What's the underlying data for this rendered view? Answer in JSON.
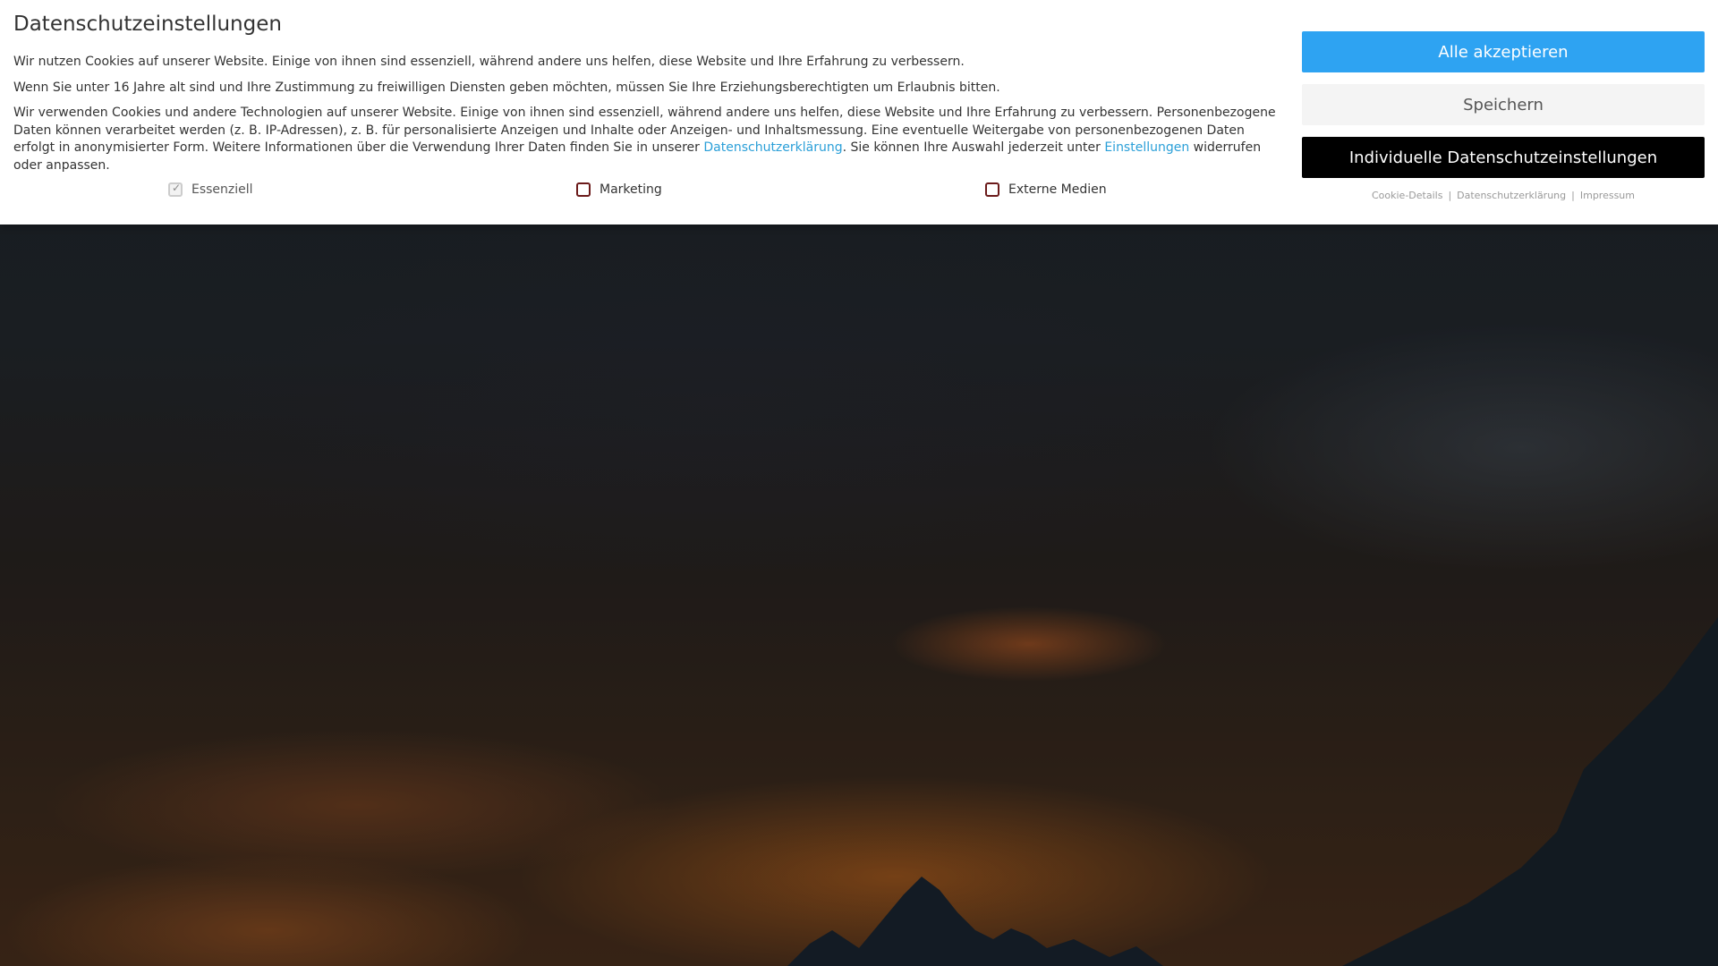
{
  "banner": {
    "title": "Datenschutzeinstellungen",
    "paragraph1": "Wir nutzen Cookies auf unserer Website. Einige von ihnen sind essenziell, während andere uns helfen, diese Website und Ihre Erfahrung zu verbessern.",
    "paragraph2": "Wenn Sie unter 16 Jahre alt sind und Ihre Zustimmung zu freiwilligen Diensten geben möchten, müssen Sie Ihre Erziehungsberechtigten um Erlaubnis bitten.",
    "paragraph3_part1": "Wir verwenden Cookies und andere Technologien auf unserer Website. Einige von ihnen sind essenziell, während andere uns helfen, diese Website und Ihre Erfahrung zu verbessern. Personenbezogene Daten können verarbeitet werden (z. B. IP-Adressen), z. B. für personalisierte Anzeigen und Inhalte oder Anzeigen- und Inhaltsmessung. Eine eventuelle Weitergabe von personenbezogenen Daten erfolgt in anonymisierter Form. Weitere Informationen über die Verwendung Ihrer Daten finden Sie in unserer ",
    "privacy_link": "Datenschutzerklärung",
    "paragraph3_part2": ". Sie können Ihre Auswahl jederzeit unter ",
    "settings_link": "Einstellungen",
    "paragraph3_part3": " widerrufen oder anpassen.",
    "categories": [
      {
        "label": "Essenziell",
        "checked": true,
        "disabled": true
      },
      {
        "label": "Marketing",
        "checked": false,
        "disabled": false
      },
      {
        "label": "Externe Medien",
        "checked": false,
        "disabled": false
      }
    ],
    "buttons": {
      "accept_all": "Alle akzeptieren",
      "save": "Speichern",
      "individual": "Individuelle Datenschutzeinstellungen"
    },
    "footer_links": {
      "cookie_details": "Cookie-Details",
      "privacy": "Datenschutzerklärung",
      "imprint": "Impressum",
      "separator": "|"
    }
  },
  "colors": {
    "accent": "#2ea3f2",
    "link": "#2a9fd8",
    "dark_button": "#000000",
    "light_button": "#f4f4f4",
    "checkbox_border": "#6b1a1a"
  }
}
